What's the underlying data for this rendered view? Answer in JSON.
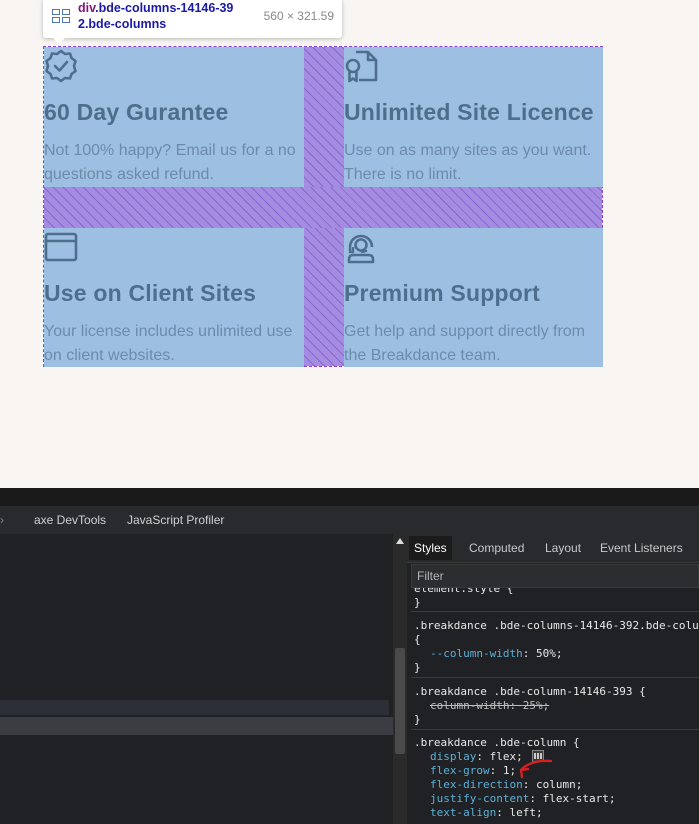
{
  "tooltip": {
    "selector_tag": "div",
    "selector_class_line1": ".bde-columns-14146-39",
    "selector_class_line2": "2.bde-columns",
    "size": "560 × 321.59"
  },
  "features": [
    {
      "icon": "badge-check-icon",
      "title": "60 Day Gurantee",
      "desc": "Not 100% happy? Email us for a no questions asked refund."
    },
    {
      "icon": "certificate-file-icon",
      "title": "Unlimited Site Licence",
      "desc": "Use on as many sites as you want. There is no limit."
    },
    {
      "icon": "browser-window-icon",
      "title": "Use on Client Sites",
      "desc": "Your license includes unlimited use on client websites."
    },
    {
      "icon": "support-headset-icon",
      "title": "Premium Support",
      "desc": "Get help and support directly from the Breakdance team."
    }
  ],
  "devtools": {
    "tabs": [
      "axe DevTools",
      "JavaScript Profiler"
    ],
    "side_tabs": [
      "Styles",
      "Computed",
      "Layout",
      "Event Listeners"
    ],
    "filter_placeholder": "Filter",
    "rules": {
      "r0_line1": "element.style {",
      "r0_line2": "}",
      "r1_selector": ".breakdance .bde-columns-14146-392.bde-colu",
      "r1_open": "{",
      "r1_prop": "--column-width",
      "r1_value": "50%;",
      "r1_close": "}",
      "r2_selector": ".breakdance .bde-column-14146-393 {",
      "r2_prop": "column-width",
      "r2_value": "25%;",
      "r2_close": "}",
      "r3_selector": ".breakdance .bde-column {",
      "r3_p1": "display",
      "r3_v1": "flex;",
      "r3_p2": "flex-grow",
      "r3_v2": "1;",
      "r3_p3": "flex-direction",
      "r3_v3": "column;",
      "r3_p4": "justify-content",
      "r3_v4": "flex-start;",
      "r3_p5": "text-align",
      "r3_v5": "left;"
    }
  },
  "colors": {
    "accent_annotation": "#d42020",
    "grid_cell": "#9dc0e2",
    "grid_gap": "#a48ce0"
  }
}
